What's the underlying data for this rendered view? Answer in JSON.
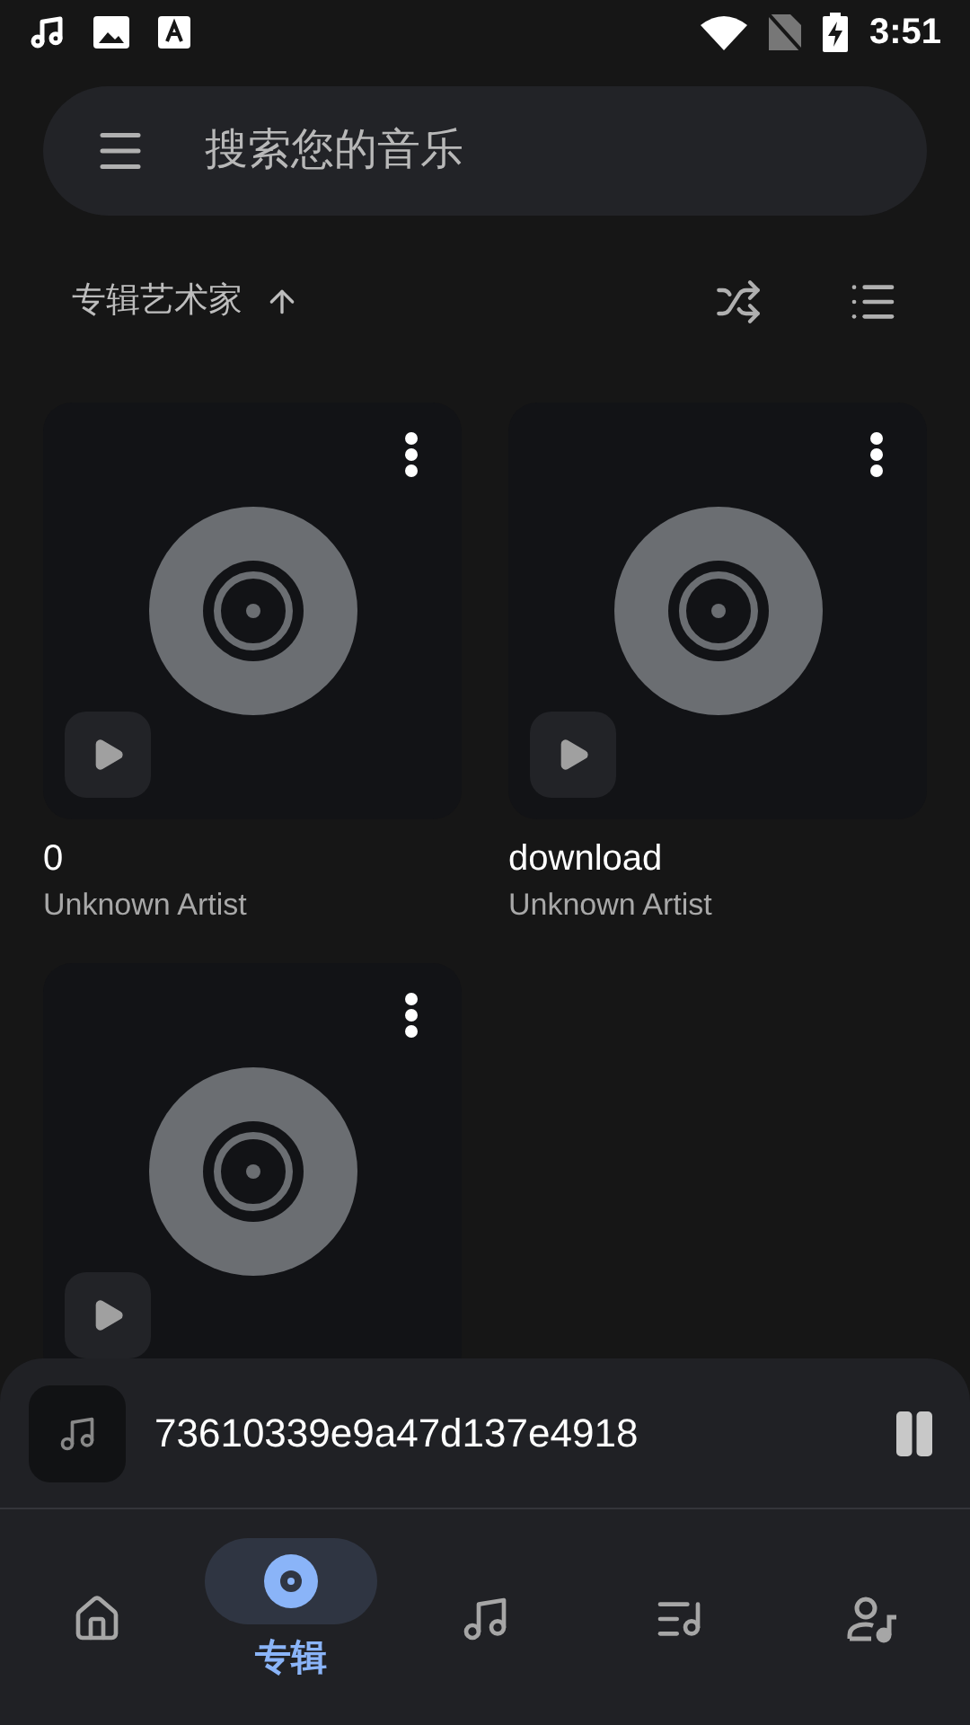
{
  "status_bar": {
    "time": "3:51"
  },
  "search": {
    "placeholder": "搜索您的音乐"
  },
  "sort": {
    "label": "专辑艺术家"
  },
  "albums": [
    {
      "kind": "album",
      "title": "0",
      "artist": "Unknown Artist"
    },
    {
      "kind": "album",
      "title": "download",
      "artist": "Unknown Artist"
    },
    {
      "kind": "cover_only"
    }
  ],
  "now_playing": {
    "title": "73610339e9a47d137e4918"
  },
  "nav": [
    {
      "kind": "home",
      "selected": false
    },
    {
      "kind": "albums",
      "selected": true,
      "label": "专辑"
    },
    {
      "kind": "songs",
      "selected": false
    },
    {
      "kind": "playlists",
      "selected": false
    },
    {
      "kind": "artists",
      "selected": false
    }
  ]
}
